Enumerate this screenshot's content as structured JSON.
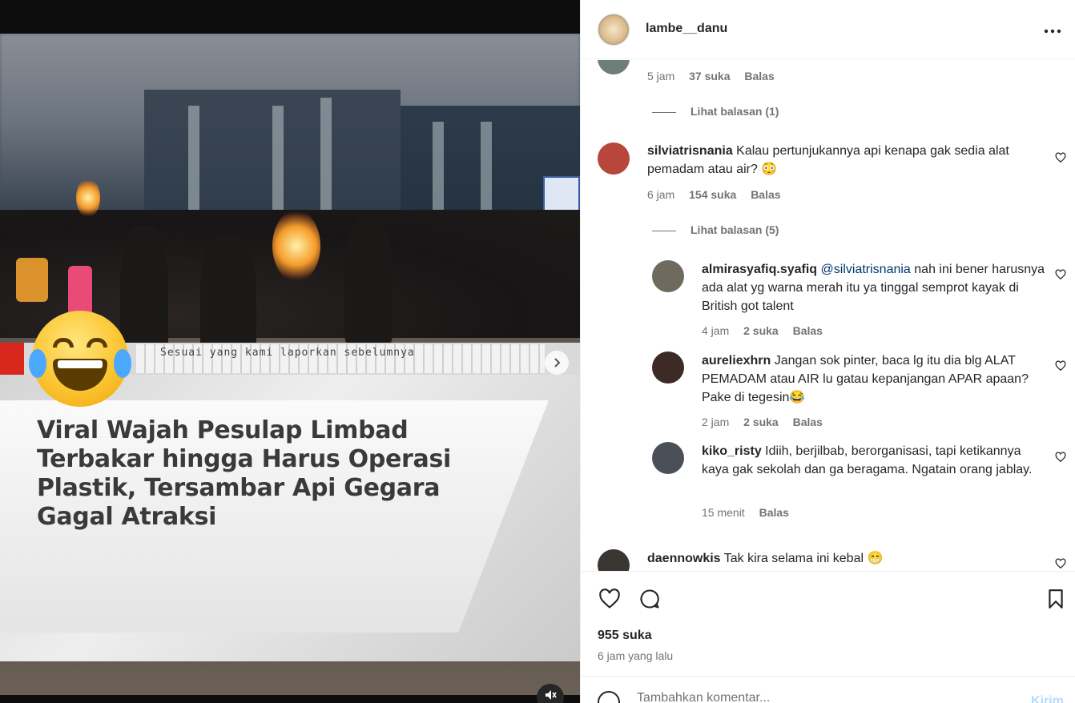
{
  "post": {
    "username": "lambe__danu",
    "more_icon": "more-horizontal-icon"
  },
  "media": {
    "headline": "Viral Wajah Pesulap Limbad Terbakar hingga Harus Operasi Plastik, Tersambar Api Gegara Gagal Atraksi",
    "ticker_text": "Sesuai yang kami laporkan sebelumnya",
    "next_icon": "chevron-right-icon",
    "mute_icon": "speaker-muted-icon"
  },
  "comments": {
    "prev": {
      "time": "5 jam",
      "likes": "37 suka",
      "reply": "Balas",
      "view_replies": "Lihat balasan (1)"
    },
    "items": [
      {
        "user": "silviatrisnania",
        "text": "Kalau pertunjukannya api kenapa gak sedia alat pemadam atau air? 😳",
        "time": "6 jam",
        "likes": "154 suka",
        "reply": "Balas",
        "view_replies": "Lihat balasan (5)"
      },
      {
        "user": "almirasyafiq.syafiq",
        "mention": "@silviatrisnania",
        "text": "nah ini bener harusnya ada alat yg warna merah itu ya tinggal semprot kayak di British got talent",
        "time": "4 jam",
        "likes": "2 suka",
        "reply": "Balas"
      },
      {
        "user": "aureliexhrn",
        "text": "Jangan sok pinter, baca lg itu dia blg ALAT PEMADAM atau AIR lu gatau kepanjangan APAR apaan? Pake di tegesin😂",
        "time": "2 jam",
        "likes": "2 suka",
        "reply": "Balas"
      },
      {
        "user": "kiko_risty",
        "text": "Idiih, berjilbab, berorganisasi, tapi ketikannya kaya gak sekolah dan ga beragama. Ngatain orang jablay.",
        "time": "15 menit",
        "reply": "Balas"
      },
      {
        "user": "daennowkis",
        "text": "Tak kira selama ini kebal 😁"
      }
    ]
  },
  "footer": {
    "likes_total": "955 suka",
    "time_ago": "6 jam yang lalu",
    "add_comment_placeholder": "Tambahkan komentar...",
    "post_label": "Kirim"
  },
  "colors": {
    "mention": "#00376b",
    "secondary_text": "#737373",
    "post_button": "#b3dbff",
    "ticker_red": "#d8271c"
  }
}
